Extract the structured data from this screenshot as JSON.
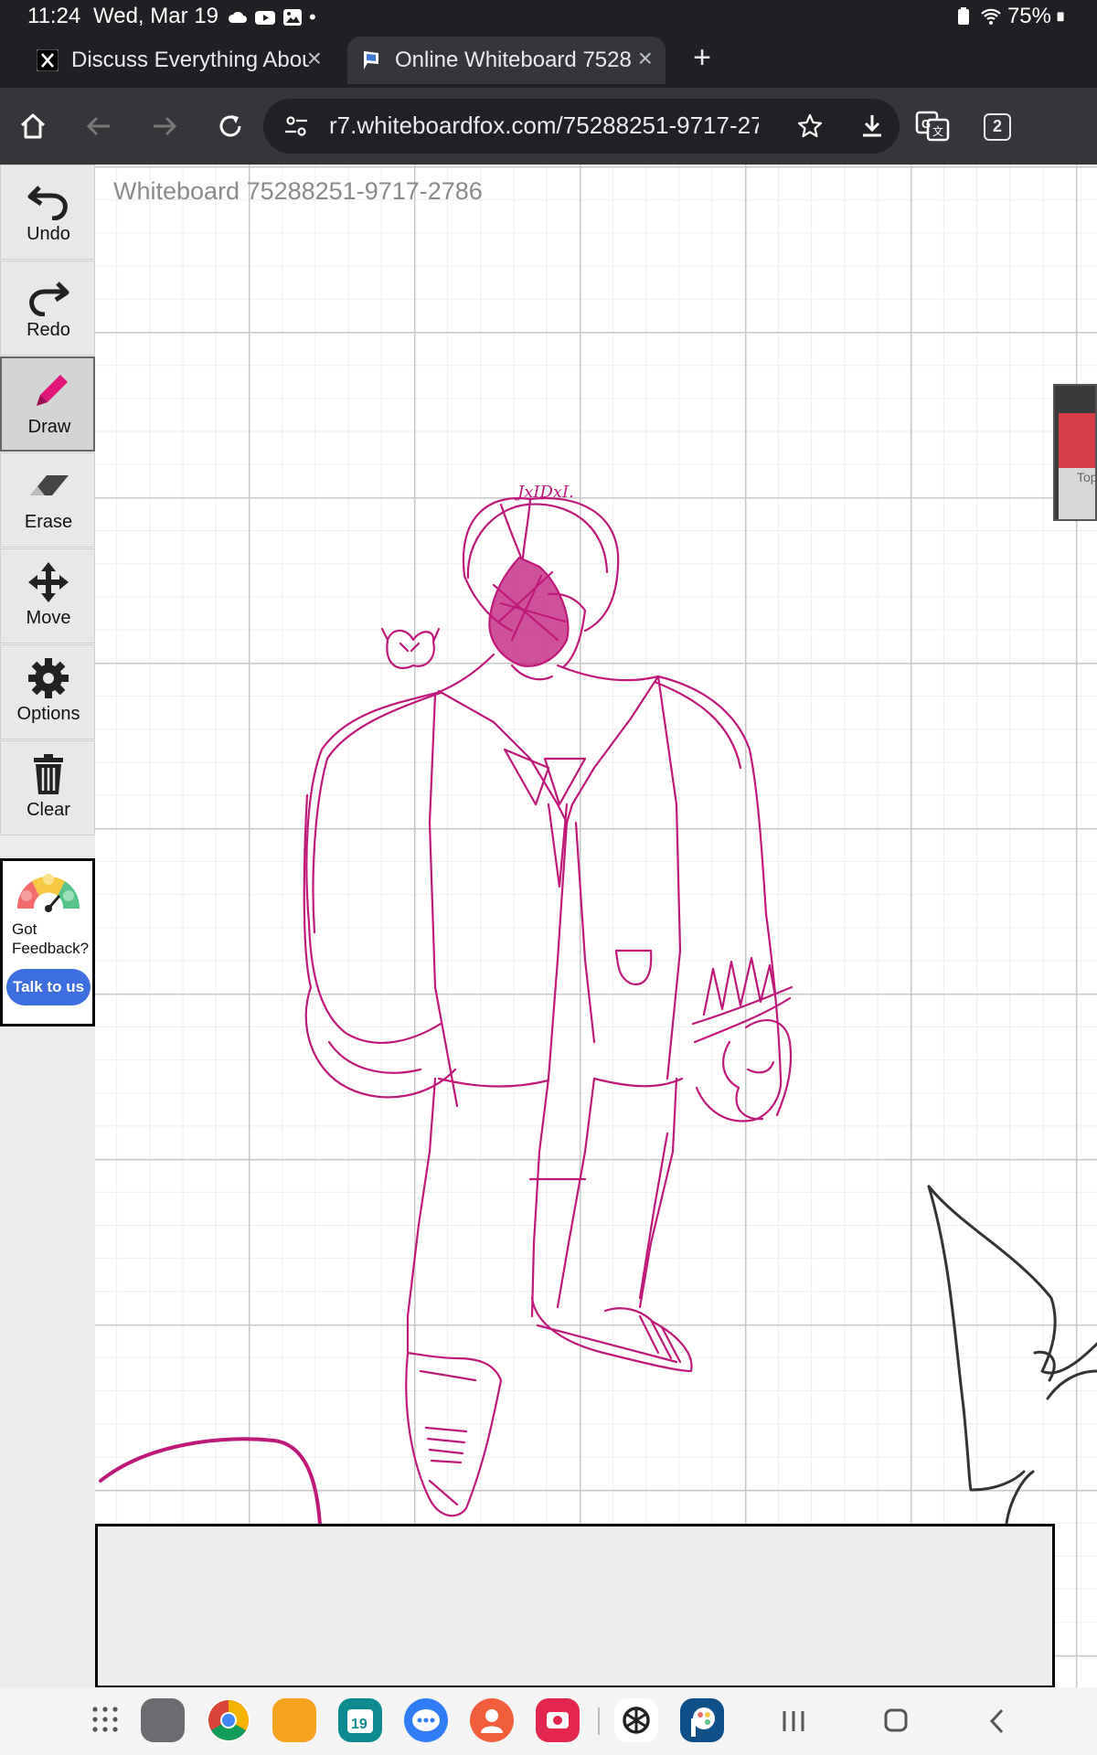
{
  "status_bar": {
    "time": "11:24",
    "date": "Wed, Mar 19",
    "battery": "75%"
  },
  "tabs": [
    {
      "label": "Discuss Everything Abou",
      "favicon": "x-logo-icon",
      "active": false
    },
    {
      "label": "Online Whiteboard 75288",
      "favicon": "whiteboard-flag-icon",
      "active": true
    }
  ],
  "toolbar": {
    "url": "r7.whiteboardfox.com/75288251-9717-27",
    "tab_count": "2"
  },
  "whiteboard": {
    "title": "Whiteboard 75288251-9717-2786",
    "signature": "JxIDxI."
  },
  "tools": [
    {
      "label": "Undo",
      "icon": "undo-icon"
    },
    {
      "label": "Redo",
      "icon": "redo-icon"
    },
    {
      "label": "Draw",
      "icon": "pencil-icon",
      "active": true
    },
    {
      "label": "Erase",
      "icon": "eraser-icon"
    },
    {
      "label": "Move",
      "icon": "move-arrows-icon"
    },
    {
      "label": "Options",
      "icon": "gear-icon"
    },
    {
      "label": "Clear",
      "icon": "trash-icon"
    }
  ],
  "feedback": {
    "line1": "Got",
    "line2": "Feedback?",
    "button": "Talk to us"
  },
  "side_thumbnail": {
    "text": "Top"
  },
  "colors": {
    "ink": "#c0177a",
    "ink_gray": "#333333",
    "accent_button": "#3d6ee0",
    "chrome_dark": "#1f2023"
  }
}
